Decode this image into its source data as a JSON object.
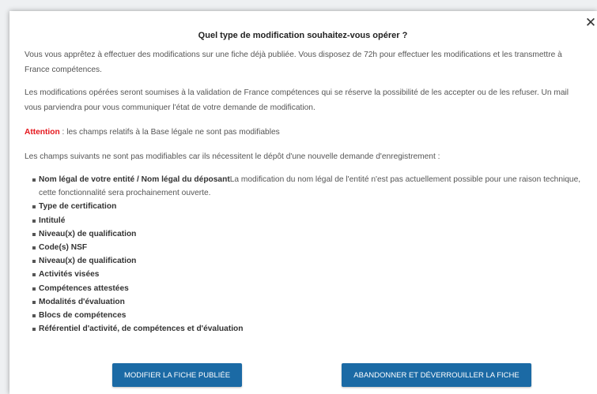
{
  "modal": {
    "title": "Quel type de modification souhaitez-vous opérer ?",
    "close_glyph": "✕",
    "paragraph1": "Vous vous apprêtez à effectuer des modifications sur une fiche déjà publiée. Vous disposez de 72h pour effectuer les modifications et les transmettre à France compétences.",
    "paragraph2": "Les modifications opérées seront soumises à la validation de France compétences qui se réserve la possibilité de les accepter ou de les refuser. Un mail vous parviendra pour vous communiquer l'état de votre demande de modification.",
    "attention_label": "Attention",
    "attention_text": " : les champs relatifs à la Base légale ne sont pas modifiables",
    "paragraph4": "Les champs suivants ne sont pas modifiables car ils nécessitent le dépôt d'une nouvelle demande d'enregistrement :",
    "fields": [
      {
        "label": "Nom légal de votre entité / Nom légal du déposant",
        "desc": "La modification du nom légal de l'entité n'est pas actuellement possible pour une raison technique, cette fonctionnalité sera prochainement ouverte."
      },
      {
        "label": "Type de certification",
        "desc": ""
      },
      {
        "label": "Intitulé",
        "desc": ""
      },
      {
        "label": "Niveau(x) de qualification",
        "desc": ""
      },
      {
        "label": "Code(s) NSF",
        "desc": ""
      },
      {
        "label": "Niveau(x) de qualification",
        "desc": ""
      },
      {
        "label": "Activités visées",
        "desc": ""
      },
      {
        "label": "Compétences attestées",
        "desc": ""
      },
      {
        "label": "Modalités d'évaluation",
        "desc": ""
      },
      {
        "label": "Blocs de compétences",
        "desc": ""
      },
      {
        "label": "Référentiel d'activité, de compétences et d'évaluation",
        "desc": ""
      }
    ],
    "buttons": {
      "modify": "MODIFIER LA FICHE PUBLIÉE",
      "abandon": "ABANDONNER ET DÉVERROUILLER LA FICHE"
    }
  },
  "colors": {
    "button_bg": "#1b6aa5",
    "attention": "#e5161c"
  }
}
